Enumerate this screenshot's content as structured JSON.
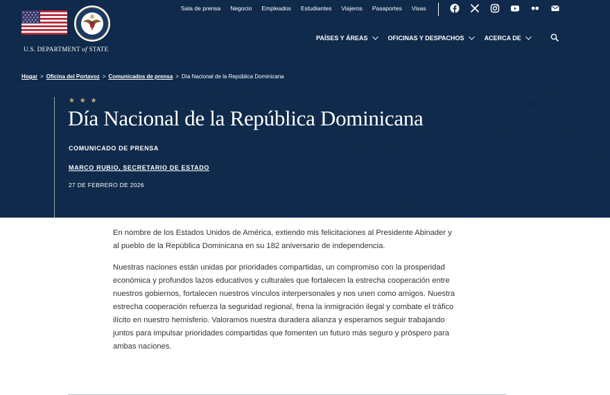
{
  "header": {
    "department_pre": "U.S. DEPARTMENT",
    "department_of": "of",
    "department_post": "STATE"
  },
  "top_nav": [
    "Sala de prensa",
    "Negocio",
    "Empleados",
    "Estudiantes",
    "Viajeros",
    "Pasaportes",
    "Visas"
  ],
  "social_icons": [
    "facebook-icon",
    "x-icon",
    "instagram-icon",
    "youtube-icon",
    "flickr-icon",
    "email-icon"
  ],
  "main_nav": [
    "PAÍSES Y ÁREAS",
    "OFICINAS Y DESPACHOS",
    "ACERCA DE"
  ],
  "breadcrumb": {
    "items": [
      "Hogar",
      "Oficina del Portavoz",
      "Comunicados de prensa"
    ],
    "current": "Día Nacional de la República Dominicana",
    "separator": ">"
  },
  "hero": {
    "stars": "★ ★ ★",
    "title": "Día Nacional de la República Dominicana",
    "kind": "COMUNICADO DE PRENSA",
    "author": "MARCO RUBIO, SECRETARIO DE ESTADO",
    "date": "27 DE FEBRERO DE 2026"
  },
  "content": {
    "paragraphs": [
      "En nombre de los Estados Unidos de América, extiendo mis felicitaciones al Presidente Abinader y al pueblo de la República Dominicana en su 182 aniversario de independencia.",
      "Nuestras naciones están unidas por prioridades compartidas, un compromiso con la prosperidad económica y profundos lazos educativos y culturales que fortalecen la estrecha cooperación entre nuestros gobiernos, fortalecen nuestros vínculos interpersonales y nos unen como amigos. Nuestra estrecha cooperación refuerza la seguridad regional, frena la inmigración ilegal y combate el tráfico ilícito en nuestro hemisferio. Valoramos nuestra duradera alianza y esperamos seguir trabajando juntos para impulsar prioridades compartidas que fomenten un futuro más seguro y próspero para ambas naciones."
    ]
  },
  "colors": {
    "hero_bg": "#0f2a4a",
    "star_gold": "#c8b07a",
    "text": "#333333"
  }
}
